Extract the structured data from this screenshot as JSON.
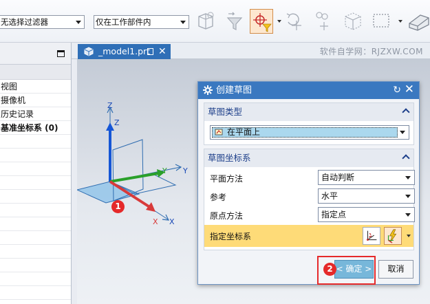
{
  "toolbar": {
    "filter_value": "无选择过滤器",
    "scope_value": "仅在工作部件内"
  },
  "navigator": {
    "rows": [
      {
        "label": "视图",
        "bold": false
      },
      {
        "label": "摄像机",
        "bold": false
      },
      {
        "label": "历史记录",
        "bold": false
      },
      {
        "label": "基准坐标系 (0)",
        "bold": true
      }
    ]
  },
  "tab": {
    "label": "_model1.prt"
  },
  "watermark": "软件自学网：RJZXW.COM",
  "scene": {
    "axis_labels": [
      "Z",
      "Z",
      "Y",
      "Y",
      "X",
      "X"
    ]
  },
  "dialog": {
    "title": "创建草图",
    "group_type": {
      "header": "草图类型",
      "selected": "在平面上"
    },
    "group_csys": {
      "header": "草图坐标系",
      "rows": [
        {
          "label": "平面方法",
          "value": "自动判断"
        },
        {
          "label": "参考",
          "value": "水平"
        },
        {
          "label": "原点方法",
          "value": "指定点"
        }
      ],
      "csys_label": "指定坐标系"
    },
    "ok_label": "< 确定 >",
    "cancel_label": "取消"
  },
  "badges": [
    "1",
    "2"
  ],
  "colors": {
    "accent_blue": "#3a78c0",
    "highlight_row": "#fedb78",
    "callout_red": "#e5292a"
  }
}
